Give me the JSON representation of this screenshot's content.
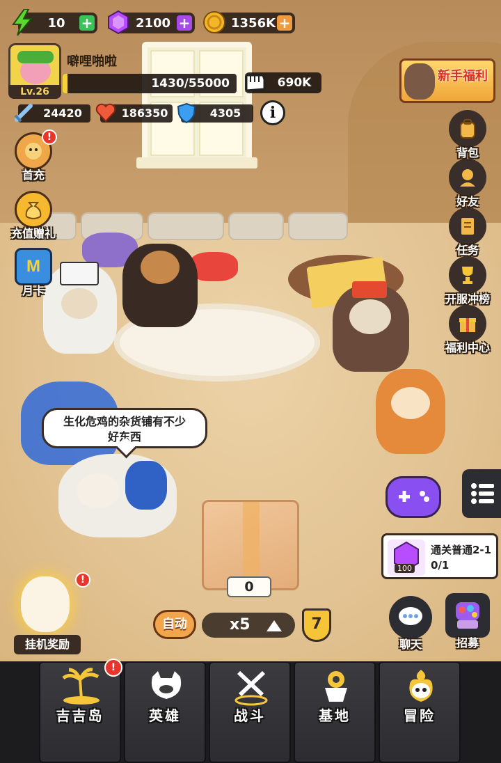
{
  "resources": {
    "energy": {
      "value": "10",
      "icon": "lightning-icon",
      "color": "#5fd62f"
    },
    "gems": {
      "value": "2100",
      "icon": "gem-icon",
      "color": "#b84cff"
    },
    "coins": {
      "value": "1356K",
      "icon": "coin-icon",
      "color": "#f4b826"
    }
  },
  "player": {
    "name": "噼哩啪啦",
    "level": "Lv.26",
    "xp_text": "1430/55000",
    "xp_fraction": 0.026,
    "power": "690K"
  },
  "stats": {
    "attack": "24420",
    "hp": "186350",
    "defense": "4305"
  },
  "left_menu": [
    {
      "label": "首充",
      "icon": "first-recharge-icon",
      "badge": "!"
    },
    {
      "label": "充值赠礼",
      "icon": "money-bag-icon"
    },
    {
      "label": "月卡",
      "icon": "monthly-card-icon"
    }
  ],
  "right_menu": [
    {
      "label": "背包",
      "icon": "backpack-icon"
    },
    {
      "label": "好友",
      "icon": "friends-icon"
    },
    {
      "label": "任务",
      "icon": "tasks-icon"
    },
    {
      "label": "开服冲榜",
      "icon": "trophy-icon"
    },
    {
      "label": "福利中心",
      "icon": "gift-box-icon"
    }
  ],
  "promo": {
    "label": "新手福利"
  },
  "speech": {
    "line1": "生化危鸡的杂货铺有不少",
    "line2": "好东西"
  },
  "crate": {
    "count": "0"
  },
  "quest": {
    "title": "通关普通2-1",
    "progress": "0/1",
    "reward_count": "100"
  },
  "controls": {
    "auto_label": "自动",
    "speed_label": "x5",
    "speed_level": "7"
  },
  "idle_reward": {
    "label": "挂机奖励",
    "badge": "!"
  },
  "bottom_actions": {
    "chat": "聊天",
    "recruit": "招募"
  },
  "nav": [
    {
      "label": "吉吉岛",
      "icon": "island-palm-icon",
      "badge": "!"
    },
    {
      "label": "英雄",
      "icon": "hero-cat-icon"
    },
    {
      "label": "战斗",
      "icon": "crossed-swords-icon"
    },
    {
      "label": "基地",
      "icon": "base-tower-icon"
    },
    {
      "label": "冒险",
      "icon": "skull-adventure-icon"
    }
  ]
}
